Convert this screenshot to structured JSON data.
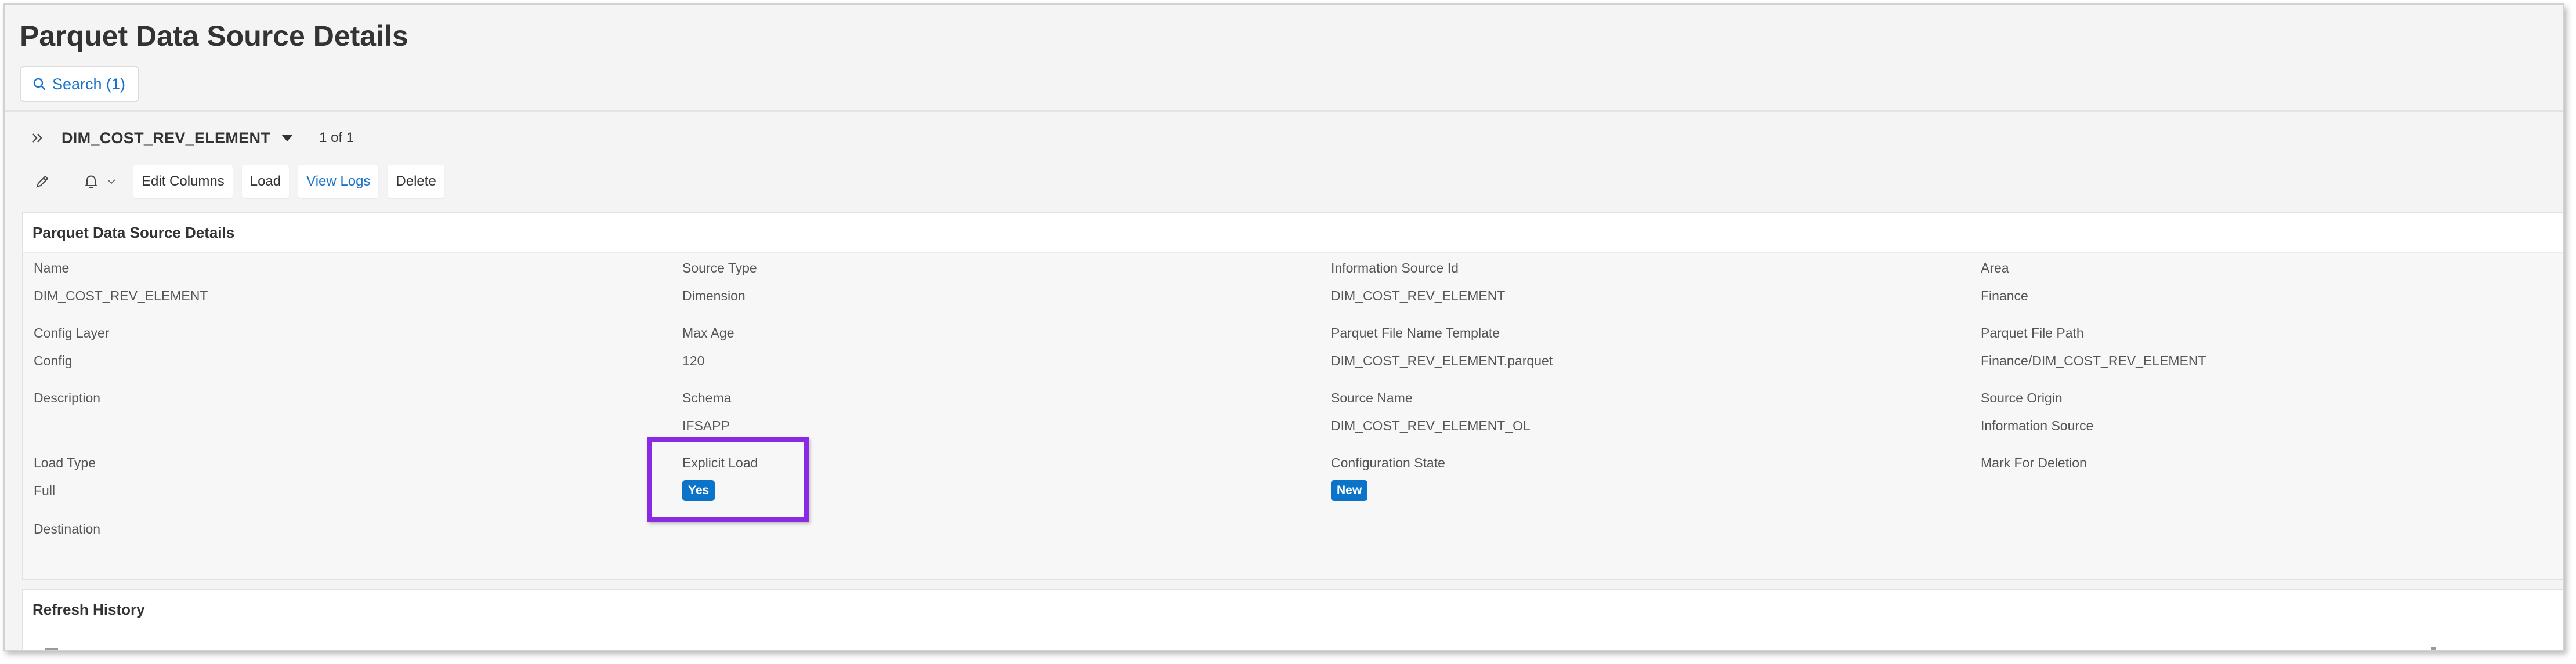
{
  "page": {
    "title": "Parquet Data Source Details"
  },
  "search": {
    "label": "Search (1)"
  },
  "record_nav": {
    "name": "DIM_COST_REV_ELEMENT",
    "count": "1 of 1"
  },
  "toolbar": {
    "edit_icon": "pencil-icon",
    "notify_icon": "bell-icon",
    "buttons": [
      "Edit Columns",
      "Load",
      "View Logs",
      "Delete"
    ]
  },
  "details": {
    "title": "Parquet Data Source Details",
    "fields": {
      "name": {
        "label": "Name",
        "value": "DIM_COST_REV_ELEMENT"
      },
      "source_type": {
        "label": "Source Type",
        "value": "Dimension"
      },
      "information_source_id": {
        "label": "Information Source Id",
        "value": "DIM_COST_REV_ELEMENT"
      },
      "area": {
        "label": "Area",
        "value": "Finance"
      },
      "config_layer": {
        "label": "Config Layer",
        "value": "Config"
      },
      "max_age": {
        "label": "Max Age",
        "value": "120"
      },
      "parquet_file_name_template": {
        "label": "Parquet File Name Template",
        "value": "DIM_COST_REV_ELEMENT.parquet"
      },
      "parquet_file_path": {
        "label": "Parquet File Path",
        "value": "Finance/DIM_COST_REV_ELEMENT"
      },
      "description": {
        "label": "Description",
        "value": ""
      },
      "schema": {
        "label": "Schema",
        "value": "IFSAPP"
      },
      "source_name": {
        "label": "Source Name",
        "value": "DIM_COST_REV_ELEMENT_OL"
      },
      "source_origin": {
        "label": "Source Origin",
        "value": "Information Source"
      },
      "load_type": {
        "label": "Load Type",
        "value": "Full"
      },
      "explicit_load": {
        "label": "Explicit Load",
        "value": "Yes"
      },
      "configuration_state": {
        "label": "Configuration State",
        "value": "New"
      },
      "mark_for_deletion": {
        "label": "Mark For Deletion",
        "value": ""
      },
      "destination": {
        "label": "Destination",
        "value": ""
      }
    }
  },
  "refresh_history": {
    "title": "Refresh History"
  },
  "colors": {
    "accent": "#1a73c8",
    "badge": "#0b73c8",
    "highlight": "#8a2be2"
  }
}
